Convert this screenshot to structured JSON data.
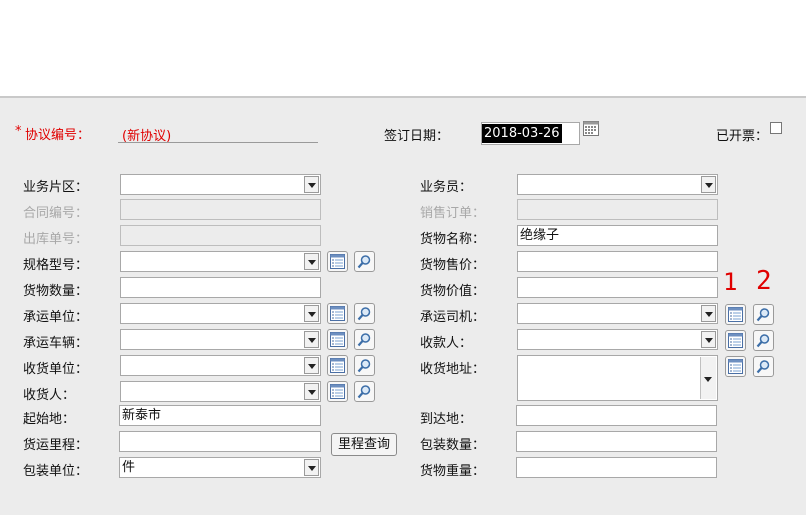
{
  "header": {
    "agreement_no_label": "协议编号：",
    "agreement_no_value": "(新协议)",
    "sign_date_label": "签订日期：",
    "sign_date_value": "2018-03-26",
    "invoiced_label": "已开票："
  },
  "left": {
    "business_area": "业务片区：",
    "contract_no": "合同编号：",
    "outbound_no": "出库单号：",
    "spec_model": "规格型号：",
    "goods_qty": "货物数量：",
    "carrier_unit": "承运单位：",
    "carrier_vehicle": "承运车辆：",
    "receiver_unit": "收货单位：",
    "receiver": "收货人：",
    "origin": "起始地：",
    "origin_value": "新泰市",
    "mileage": "货运里程：",
    "mileage_button": "里程查询",
    "package_unit": "包装单位：",
    "package_unit_value": "件"
  },
  "right": {
    "salesman": "业务员：",
    "sales_order": "销售订单：",
    "goods_name": "货物名称：",
    "goods_name_value": "绝缘子",
    "goods_price": "货物售价：",
    "goods_value": "货物价值：",
    "driver": "承运司机：",
    "payee": "收款人：",
    "receive_address": "收货地址：",
    "destination": "到达地：",
    "package_qty": "包装数量：",
    "goods_weight": "货物重量："
  },
  "annotations": {
    "one": "1",
    "two": "2"
  },
  "icons": {
    "list": "list-icon",
    "search": "magnifier-icon",
    "calendar": "calendar-icon"
  },
  "colors": {
    "required": "#e00000",
    "panel_bg": "#ececec",
    "date_highlight": "#000000"
  }
}
